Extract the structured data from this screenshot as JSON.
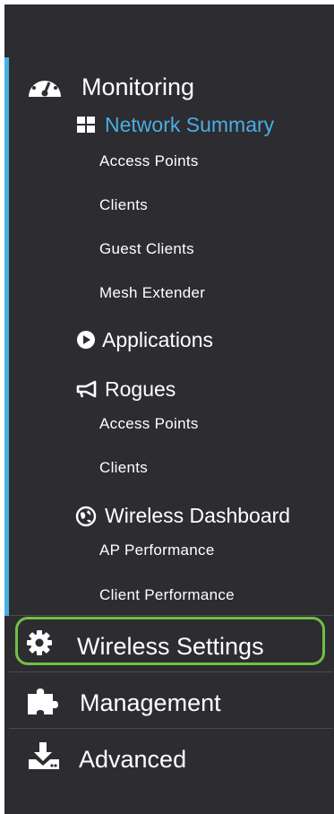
{
  "menu": {
    "monitoring": {
      "label": "Monitoring",
      "icon": "dashboard-gauge-icon",
      "network_summary": {
        "label": "Network Summary",
        "icon": "grid-icon",
        "items": [
          "Access Points",
          "Clients",
          "Guest Clients",
          "Mesh Extender"
        ]
      },
      "applications": {
        "label": "Applications",
        "icon": "play-circle-icon"
      },
      "rogues": {
        "label": "Rogues",
        "icon": "megaphone-icon",
        "items": [
          "Access Points",
          "Clients"
        ]
      },
      "wireless_dashboard": {
        "label": "Wireless Dashboard",
        "icon": "globe-icon",
        "items": [
          "AP Performance",
          "Client Performance"
        ]
      }
    },
    "wireless_settings": {
      "label": "Wireless Settings",
      "icon": "gear-icon"
    },
    "management": {
      "label": "Management",
      "icon": "puzzle-icon"
    },
    "advanced": {
      "label": "Advanced",
      "icon": "download-icon"
    }
  },
  "colors": {
    "panel_bg": "#2d2c31",
    "accent": "#4aaee2",
    "highlight": "#71bf44",
    "text": "#ffffff"
  }
}
